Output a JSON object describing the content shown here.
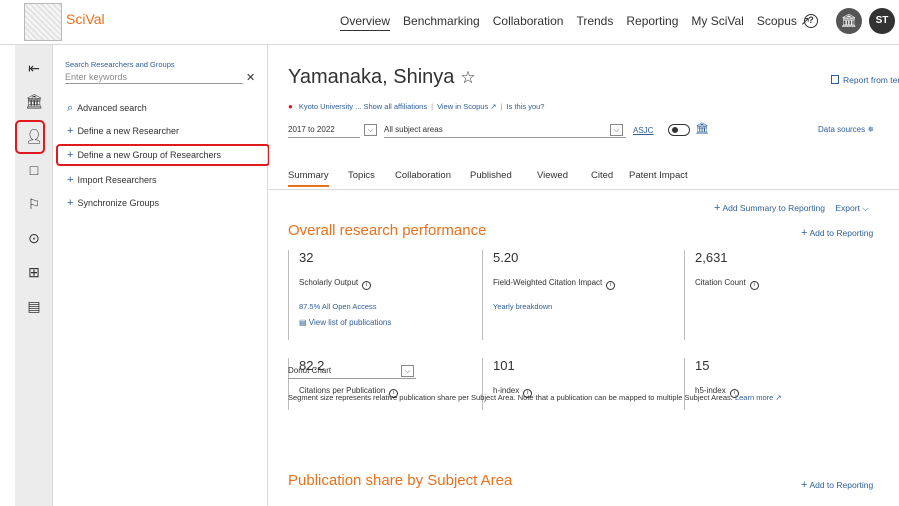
{
  "app": {
    "name": "SciVal"
  },
  "topnav": {
    "items": [
      "Overview",
      "Benchmarking",
      "Collaboration",
      "Trends",
      "Reporting",
      "My SciVal",
      "Scopus ↗"
    ],
    "active": "Overview"
  },
  "user": {
    "initials": "ST"
  },
  "search": {
    "label": "Search Researchers and Groups",
    "placeholder": "Enter keywords",
    "value": ""
  },
  "panel": {
    "advanced": "Advanced search",
    "define_researcher": "Define a new Researcher",
    "define_group": "Define a new Group of Researchers",
    "import": "Import Researchers",
    "sync": "Synchronize Groups"
  },
  "profile": {
    "name": "Yamanaka, Shinya",
    "report_template": "Report from template",
    "affiliation": "Kyoto University ... Show all affiliations",
    "view_scopus": "View in Scopus ↗",
    "is_this_you": "Is this you?",
    "year_range": "2017 to 2022",
    "subject_areas": "All subject areas",
    "asjc": "ASJC",
    "data_sources": "Data sources"
  },
  "tabs": [
    "Summary",
    "Topics",
    "Collaboration",
    "Published",
    "Viewed",
    "Cited",
    "Patent Impact"
  ],
  "summary": {
    "add_summary": "Add Summary to Reporting",
    "export": "Export",
    "overall_title": "Overall research performance",
    "add_to_reporting": "Add to Reporting",
    "metrics": [
      {
        "value": "32",
        "label": "Scholarly Output",
        "sub": "87.5% All Open Access",
        "sub2": "View list of publications"
      },
      {
        "value": "5.20",
        "label": "Field-Weighted Citation Impact",
        "sub": "Yearly breakdown"
      },
      {
        "value": "2,631",
        "label": "Citation Count"
      },
      {
        "value": "82.2",
        "label": "Citations per Publication"
      },
      {
        "value": "101",
        "label": "h-index"
      },
      {
        "value": "15",
        "label": "h5-index"
      }
    ],
    "pub_share_title": "Publication share by Subject Area",
    "chart_type": "Donut Chart",
    "footnote": "Segment size represents relative publication share per Subject Area. Note that a publication can be mapped to multiple Subject Areas.",
    "learn_more": "Learn more ↗"
  },
  "colors": {
    "accent": "#e9711c",
    "link": "#2e5f9b",
    "highlight": "#e0191c"
  }
}
